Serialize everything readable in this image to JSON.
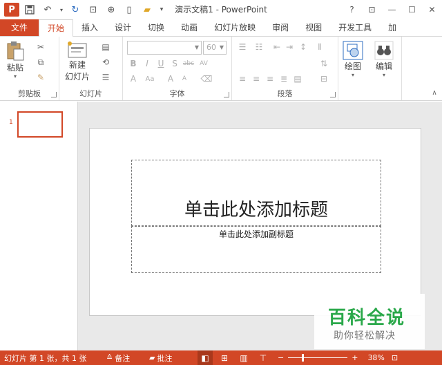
{
  "window": {
    "title": "演示文稿1 - PowerPoint",
    "help": "?",
    "logo_letter": "P"
  },
  "quick_access": {
    "save_icon": "save-icon",
    "undo_icon": "undo-icon",
    "redo_icon": "redo-icon"
  },
  "tabs": [
    {
      "label": "文件"
    },
    {
      "label": "开始"
    },
    {
      "label": "插入"
    },
    {
      "label": "设计"
    },
    {
      "label": "切换"
    },
    {
      "label": "动画"
    },
    {
      "label": "幻灯片放映"
    },
    {
      "label": "审阅"
    },
    {
      "label": "视图"
    },
    {
      "label": "开发工具"
    },
    {
      "label": "加"
    }
  ],
  "ribbon": {
    "clipboard": {
      "label": "剪贴板",
      "paste": "粘贴"
    },
    "slides": {
      "label": "幻灯片",
      "new_slide_line1": "新建",
      "new_slide_line2": "幻灯片"
    },
    "font": {
      "label": "字体",
      "font_size": "60"
    },
    "paragraph": {
      "label": "段落"
    },
    "drawing": {
      "label": "绘图"
    },
    "editing": {
      "label": "编辑"
    }
  },
  "thumbnails": [
    {
      "number": "1"
    }
  ],
  "slide": {
    "title_placeholder": "单击此处添加标题",
    "subtitle_placeholder": "单击此处添加副标题"
  },
  "watermark": {
    "main": "百科全说",
    "sub": "助你轻松解决"
  },
  "status": {
    "slide_info": "幻灯片 第 1 张，共 1 张",
    "notes": "备注",
    "comments": "批注",
    "zoom": "38%",
    "zoom_minus": "−",
    "zoom_plus": "+"
  },
  "colors": {
    "accent": "#d24726"
  }
}
